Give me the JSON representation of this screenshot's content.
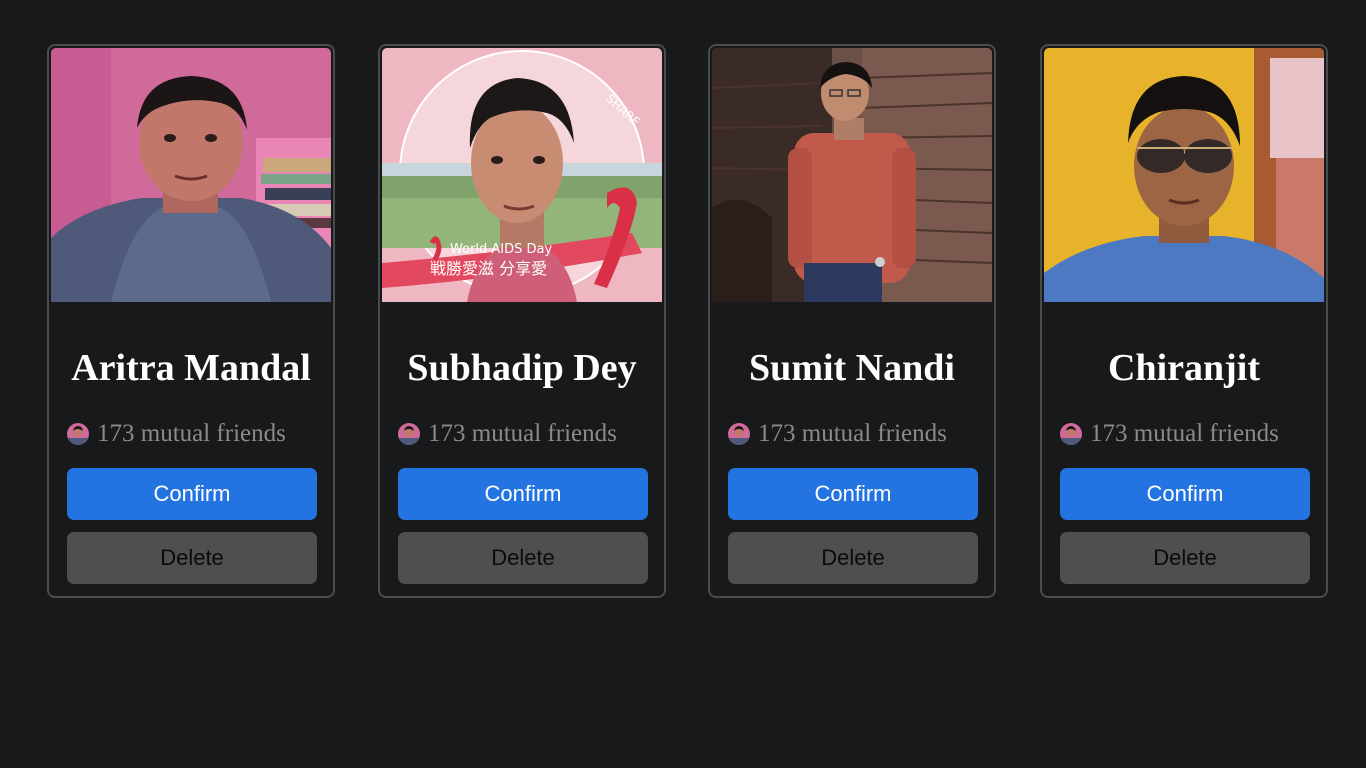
{
  "colors": {
    "page_background": "#18191a",
    "card_border": "#4a4b4d",
    "confirm_button": "#2374e1",
    "delete_button": "#4e4f50",
    "mutual_text": "#8a8b8d"
  },
  "requests": [
    {
      "name": "Aritra Mandal",
      "mutual_friends": "173 mutual friends",
      "confirm_label": "Confirm",
      "delete_label": "Delete"
    },
    {
      "name": "Subhadip Dey",
      "mutual_friends": "173 mutual friends",
      "confirm_label": "Confirm",
      "delete_label": "Delete",
      "photo_text": {
        "banner": "World AIDS Day",
        "slogan": "戦勝愛滋 分享愛",
        "badge": "SHARE"
      }
    },
    {
      "name": "Sumit Nandi",
      "mutual_friends": "173 mutual friends",
      "confirm_label": "Confirm",
      "delete_label": "Delete"
    },
    {
      "name": "Chiranjit",
      "mutual_friends": "173 mutual friends",
      "confirm_label": "Confirm",
      "delete_label": "Delete"
    }
  ]
}
